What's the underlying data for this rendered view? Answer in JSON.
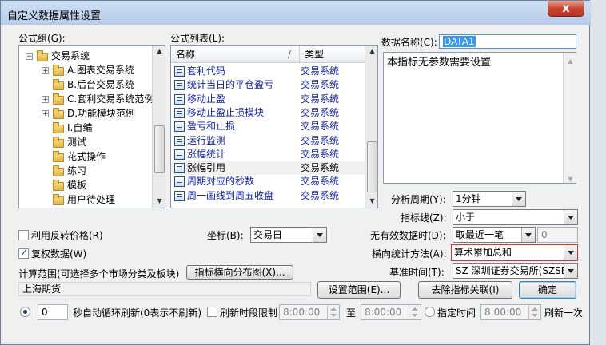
{
  "window": {
    "title": "自定义数据属性设置",
    "close_label": "x"
  },
  "formula_group": {
    "label": "公式组(G):",
    "tree": [
      {
        "label": "交易系统",
        "expander": "−",
        "children": true
      },
      {
        "label": "A.图表交易系统",
        "expander": "+"
      },
      {
        "label": "B.后台交易系统",
        "expander": ""
      },
      {
        "label": "C.套利交易系统范例",
        "expander": "+"
      },
      {
        "label": "D.功能模块范例",
        "expander": "+"
      },
      {
        "label": "I.自编",
        "expander": ""
      },
      {
        "label": "测试",
        "expander": ""
      },
      {
        "label": "花式操作",
        "expander": ""
      },
      {
        "label": "练习",
        "expander": ""
      },
      {
        "label": "模板",
        "expander": ""
      },
      {
        "label": "用户待处理",
        "expander": ""
      }
    ]
  },
  "formula_list": {
    "label": "公式列表(L):",
    "col_name": "名称",
    "col_sep": "/",
    "col_type": "类型",
    "rows": [
      {
        "name": "套利代码",
        "type": "交易系统",
        "blue": true
      },
      {
        "name": "统计当日的平仓盈亏",
        "type": "交易系统",
        "blue": true
      },
      {
        "name": "移动止盈",
        "type": "交易系统",
        "blue": true
      },
      {
        "name": "移动止盈止损模块",
        "type": "交易系统",
        "blue": true
      },
      {
        "name": "盈亏和止损",
        "type": "交易系统",
        "blue": true
      },
      {
        "name": "运行监测",
        "type": "交易系统",
        "blue": true
      },
      {
        "name": "涨幅统计",
        "type": "交易系统",
        "blue": true
      },
      {
        "name": "涨幅引用",
        "type": "交易系统",
        "blue": false
      },
      {
        "name": "周期对应的秒数",
        "type": "交易系统",
        "blue": true
      },
      {
        "name": "周一画线到周五收盘",
        "type": "交易系统",
        "blue": true
      }
    ]
  },
  "data_name": {
    "label": "数据名称(C):",
    "value": "DATA1"
  },
  "description": "本指标无参数需要设置",
  "period": {
    "label": "分析周期(Y):",
    "value": "1分钟"
  },
  "indicator_line": {
    "label": "指标线(Z):",
    "value": "小于"
  },
  "options": {
    "reverse_price": "利用反转价格(R)",
    "adjusted": "复权数据(W)"
  },
  "coordinate": {
    "label": "坐标(B):",
    "value": "交易日"
  },
  "invalid_data": {
    "label": "无有效数据时(D):",
    "value": "取最近一笔",
    "number": "0"
  },
  "horizontal_stat": {
    "label": "横向统计方法(A):",
    "value": "算术累加总和"
  },
  "base_time": {
    "label": "基准时间(T):",
    "value": "SZ 深圳证券交易所(SZSE)"
  },
  "calc_range": {
    "label": "计算范围(可选择多个市场分类及板块)",
    "dist_button": "指标横向分布图(X)...",
    "value": "上海期货",
    "set_button": "设置范围(E)..."
  },
  "remove_link_button": "去除指标关联(I)",
  "ok_button": "确定",
  "refresh": {
    "seconds": "0",
    "seconds_label": "秒自动循环刷新(0表示不刷新)",
    "period_limit": "刷新时段限制",
    "from": "8:00:00",
    "to_label": "至",
    "to": "8:00:00",
    "fixed_time": "指定时间",
    "fixed_value": "8:00:00",
    "refresh_once": "刷新一次"
  }
}
